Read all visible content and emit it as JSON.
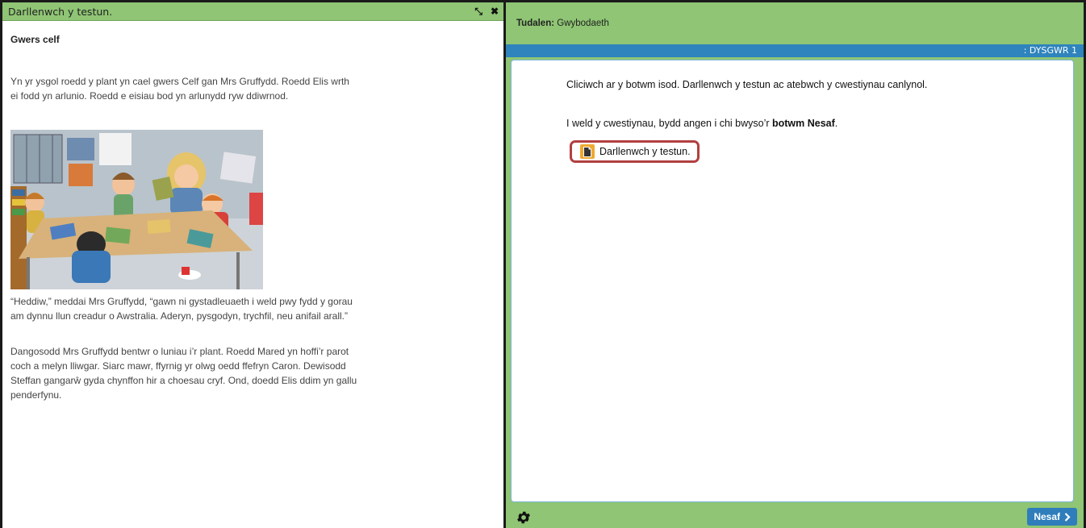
{
  "left_panel": {
    "title": "Darllenwch y testun.",
    "controls": {
      "minimize": "⤡",
      "close": "✖"
    },
    "story_title": "Gwers celf",
    "paragraphs": [
      "Yn yr ysgol roedd y plant yn cael gwers Celf gan Mrs Gruffydd. Roedd Elis wrth ei fodd yn arlunio. Roedd e eisiau bod yn arlunydd ryw ddiwrnod.",
      "“Heddiw,” meddai Mrs Gruffydd, “gawn ni gystadleuaeth i weld pwy fydd y gorau am dynnu llun creadur o Awstralia. Aderyn, pysgodyn, trychfil, neu anifail arall.”",
      "Dangosodd Mrs Gruffydd bentwr o luniau i’r plant. Roedd Mared yn hoffi’r parot coch a melyn lliwgar. Siarc mawr, ffyrnig yr olwg oedd ffefryn Caron. Dewisodd Steffan gangarŵ gyda chynffon hir a choesau cryf. Ond, doedd Elis ddim yn gallu penderfynu."
    ]
  },
  "right_panel": {
    "page_label_prefix": "Tudalen:",
    "page_label_value": "Gwybodaeth",
    "learner_label": ": DYSGWR 1",
    "instruction_1": "Cliciwch ar y botwm isod. Darllenwch y testun ac atebwch y cwestiynau canlynol.",
    "instruction_2_prefix": "I weld y cwestiynau, bydd angen i chi bwyso’r ",
    "instruction_2_bold": "botwm Nesaf",
    "instruction_2_suffix": ".",
    "read_button_label": "Darllenwch y testun.",
    "next_button_label": "Nesaf"
  },
  "icons": {
    "settings": "gear-icon",
    "document": "document-icon",
    "next": "chevron-right-icon"
  },
  "colors": {
    "header_green": "#8fc574",
    "bar_blue": "#2f84bd",
    "highlight_red": "#b2403f",
    "button_blue": "#2f7dbb"
  }
}
